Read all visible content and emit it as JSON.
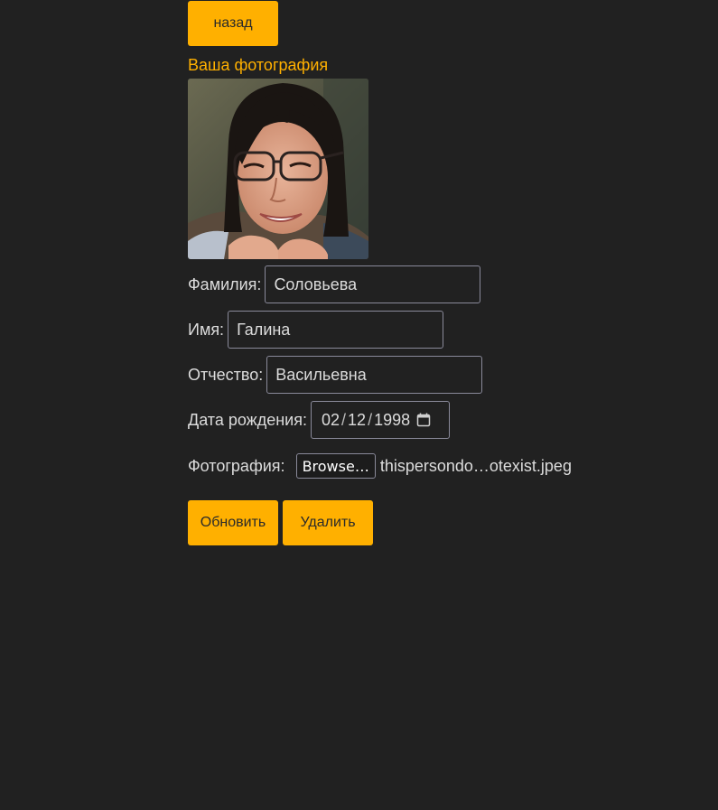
{
  "nav": {
    "back_label": "назад"
  },
  "photo": {
    "heading": "Ваша фотография"
  },
  "form": {
    "last_name_label": "Фамилия:",
    "last_name_value": "Соловьева",
    "first_name_label": "Имя:",
    "first_name_value": "Галина",
    "patronymic_label": "Отчество:",
    "patronymic_value": "Васильевна",
    "birth_date_label": "Дата рождения:",
    "birth_month": "02",
    "birth_day": "12",
    "birth_year": "1998",
    "date_separator": "/",
    "calendar_icon": "calendar-icon",
    "photo_label": "Фотография:",
    "browse_label": "Browse…",
    "file_name": "thispersondo…otexist.jpeg"
  },
  "actions": {
    "update_label": "Обновить",
    "delete_label": "Удалить"
  },
  "colors": {
    "background": "#212121",
    "accent": "#ffb000",
    "text": "#dcdcdc",
    "border": "#8a8a9a"
  }
}
